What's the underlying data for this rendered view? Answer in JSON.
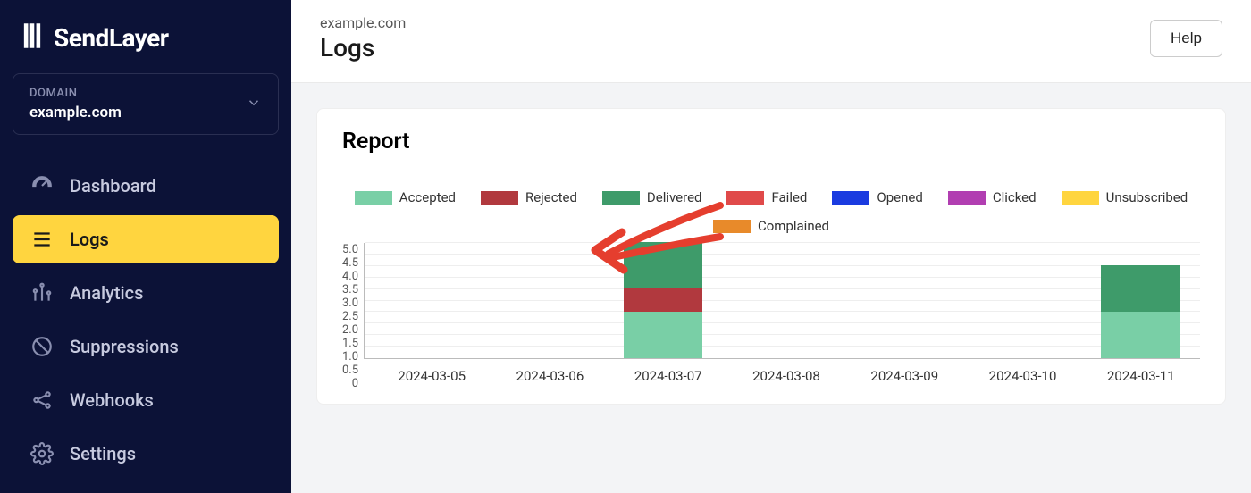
{
  "brand": {
    "name": "SendLayer"
  },
  "domain_selector": {
    "label": "DOMAIN",
    "value": "example.com"
  },
  "sidebar": {
    "items": [
      {
        "id": "dashboard",
        "label": "Dashboard",
        "active": false
      },
      {
        "id": "logs",
        "label": "Logs",
        "active": true
      },
      {
        "id": "analytics",
        "label": "Analytics",
        "active": false
      },
      {
        "id": "suppressions",
        "label": "Suppressions",
        "active": false
      },
      {
        "id": "webhooks",
        "label": "Webhooks",
        "active": false
      },
      {
        "id": "settings",
        "label": "Settings",
        "active": false
      }
    ]
  },
  "header": {
    "breadcrumb": "example.com",
    "title": "Logs",
    "help_label": "Help"
  },
  "report": {
    "title": "Report",
    "legend": {
      "accepted": "Accepted",
      "rejected": "Rejected",
      "delivered": "Delivered",
      "failed": "Failed",
      "opened": "Opened",
      "clicked": "Clicked",
      "unsubscribed": "Unsubscribed",
      "complained": "Complained"
    },
    "colors": {
      "accepted": "#79cfa6",
      "rejected": "#b1393e",
      "delivered": "#3e9b6a",
      "failed": "#e04a4a",
      "opened": "#1a3be0",
      "clicked": "#b13eb1",
      "unsubscribed": "#ffd53f",
      "complained": "#e88a2a"
    }
  },
  "chart_data": {
    "type": "bar",
    "stacked": true,
    "title": "Report",
    "ylabel": "",
    "xlabel": "",
    "ylim": [
      0,
      5
    ],
    "yticks": [
      0,
      0.5,
      1.0,
      1.5,
      2.0,
      2.5,
      3.0,
      3.5,
      4.0,
      4.5,
      5.0
    ],
    "categories": [
      "2024-03-05",
      "2024-03-06",
      "2024-03-07",
      "2024-03-08",
      "2024-03-09",
      "2024-03-10",
      "2024-03-11"
    ],
    "series": [
      {
        "name": "Accepted",
        "color": "#79cfa6",
        "values": [
          0,
          0,
          2,
          0,
          0,
          0,
          2
        ]
      },
      {
        "name": "Rejected",
        "color": "#b1393e",
        "values": [
          0,
          0,
          1,
          0,
          0,
          0,
          0
        ]
      },
      {
        "name": "Delivered",
        "color": "#3e9b6a",
        "values": [
          0,
          0,
          2,
          0,
          0,
          0,
          2
        ]
      },
      {
        "name": "Failed",
        "color": "#e04a4a",
        "values": [
          0,
          0,
          0,
          0,
          0,
          0,
          0
        ]
      },
      {
        "name": "Opened",
        "color": "#1a3be0",
        "values": [
          0,
          0,
          0,
          0,
          0,
          0,
          0
        ]
      },
      {
        "name": "Clicked",
        "color": "#b13eb1",
        "values": [
          0,
          0,
          0,
          0,
          0,
          0,
          0
        ]
      },
      {
        "name": "Unsubscribed",
        "color": "#ffd53f",
        "values": [
          0,
          0,
          0,
          0,
          0,
          0,
          0
        ]
      },
      {
        "name": "Complained",
        "color": "#e88a2a",
        "values": [
          0,
          0,
          0,
          0,
          0,
          0,
          0
        ]
      }
    ]
  }
}
